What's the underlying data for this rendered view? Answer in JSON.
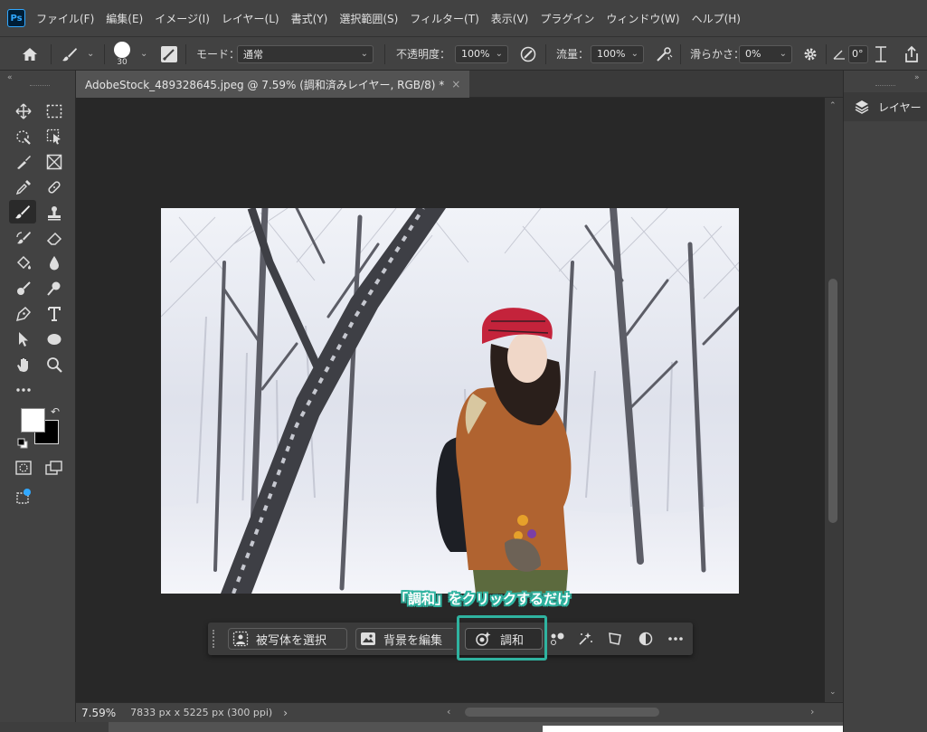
{
  "app": {
    "logo_text": "Ps"
  },
  "menu": [
    "ファイル(F)",
    "編集(E)",
    "イメージ(I)",
    "レイヤー(L)",
    "書式(Y)",
    "選択範囲(S)",
    "フィルター(T)",
    "表示(V)",
    "プラグイン",
    "ウィンドウ(W)",
    "ヘルプ(H)"
  ],
  "options": {
    "brush_size": "30",
    "mode_label": "モード：",
    "mode_value": "通常",
    "opacity_label": "不透明度：",
    "opacity_value": "100%",
    "flow_label": "流量：",
    "flow_value": "100%",
    "smoothing_label": "滑らかさ：",
    "smoothing_value": "0%",
    "angle_value": "0°"
  },
  "document": {
    "tab_title": "AdobeStock_489328645.jpeg @ 7.59% (調和済みレイヤー, RGB/8) *",
    "close_glyph": "×"
  },
  "status": {
    "zoom": "7.59%",
    "info": "7833 px x 5225 px (300 ppi)",
    "arrow": "›"
  },
  "right_panel": {
    "layers_label": "レイヤー"
  },
  "taskbar": {
    "select_subject": "被写体を選択",
    "edit_background": "背景を編集",
    "harmonize": "調和"
  },
  "annotation": {
    "text": "「調和」をクリックするだけ"
  },
  "colors": {
    "accent": "#2fb3a0",
    "ps_blue": "#31a8ff"
  }
}
